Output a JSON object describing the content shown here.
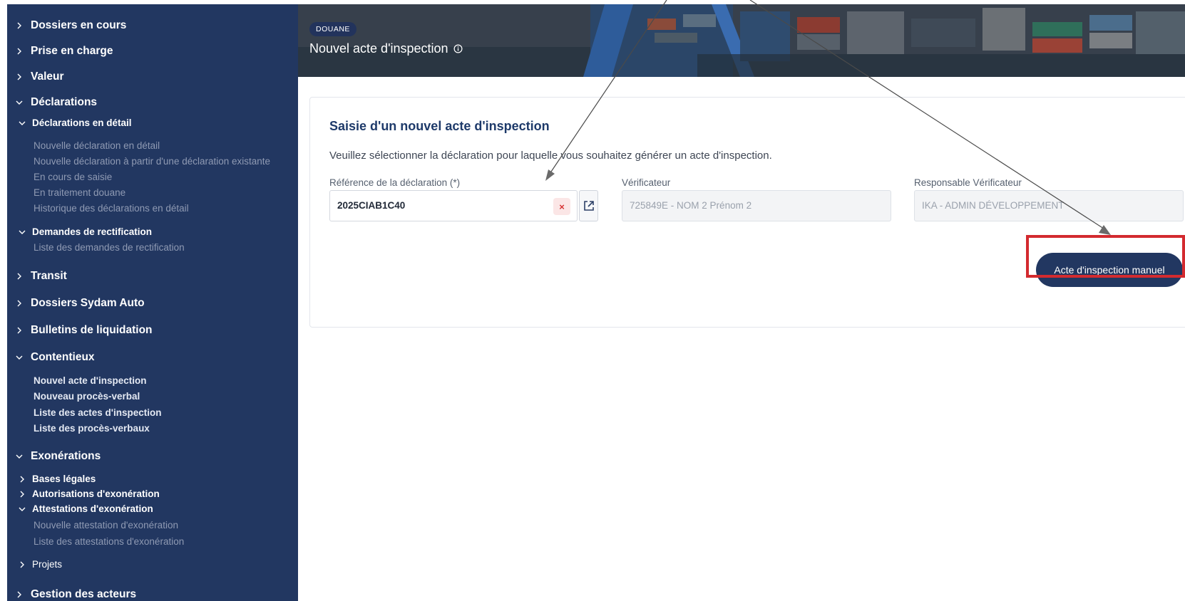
{
  "sidebar": {
    "dossiers_en_cours": "Dossiers en cours",
    "prise_en_charge": "Prise en charge",
    "valeur": "Valeur",
    "declarations": "Déclarations",
    "declarations_en_detail": "Déclarations en détail",
    "nouvelle_declaration_en_detail": "Nouvelle déclaration en détail",
    "nouvelle_declaration_existante": "Nouvelle déclaration à partir d'une déclaration existante",
    "en_cours_de_saisie": "En cours de saisie",
    "en_traitement_douane": "En traitement douane",
    "historique_declarations": "Historique des déclarations en détail",
    "demandes_de_rectification": "Demandes de rectification",
    "liste_demandes_rectification": "Liste des demandes de rectification",
    "transit": "Transit",
    "dossiers_sydam_auto": "Dossiers Sydam Auto",
    "bulletins_de_liquidation": "Bulletins de liquidation",
    "contentieux": "Contentieux",
    "nouvel_acte_inspection": "Nouvel acte d'inspection",
    "nouveau_proces_verbal": "Nouveau procès-verbal",
    "liste_actes_inspection": "Liste des actes d'inspection",
    "liste_proces_verbaux": "Liste des procès-verbaux",
    "exonerations": "Exonérations",
    "bases_legales": "Bases légales",
    "autorisations_exoneration": "Autorisations d'exonération",
    "attestations_exoneration": "Attestations d'exonération",
    "nouvelle_attestation_exoneration": "Nouvelle attestation d'exonération",
    "liste_attestations_exoneration": "Liste des attestations d'exonération",
    "projets": "Projets",
    "gestion_des_acteurs": "Gestion des acteurs"
  },
  "header": {
    "badge": "DOUANE",
    "title": "Nouvel acte d'inspection"
  },
  "form": {
    "title": "Saisie d'un nouvel acte d'inspection",
    "description": "Veuillez sélectionner la déclaration pour laquelle vous souhaitez générer un acte d'inspection.",
    "reference_label": "Référence de la déclaration (*)",
    "reference_value": "2025CIAB1C40",
    "clear_symbol": "×",
    "verificateur_label": "Vérificateur",
    "verificateur_value": "725849E - NOM 2 Prénom 2",
    "responsable_label": "Responsable Vérificateur",
    "responsable_value": "IKA - ADMIN DÉVELOPPEMENT",
    "manual_button": "Acte d'inspection manuel"
  },
  "colors": {
    "sidebar_bg": "#223761",
    "primary": "#223761",
    "title": "#1e3a6a",
    "highlight": "#d32a2f",
    "clear": "#d63333"
  },
  "icons": {
    "chevron_collapsed": "chevron-right-icon",
    "chevron_expanded": "chevron-down-icon",
    "info": "info-icon",
    "external_link": "external-link-icon",
    "clear": "close-icon"
  }
}
